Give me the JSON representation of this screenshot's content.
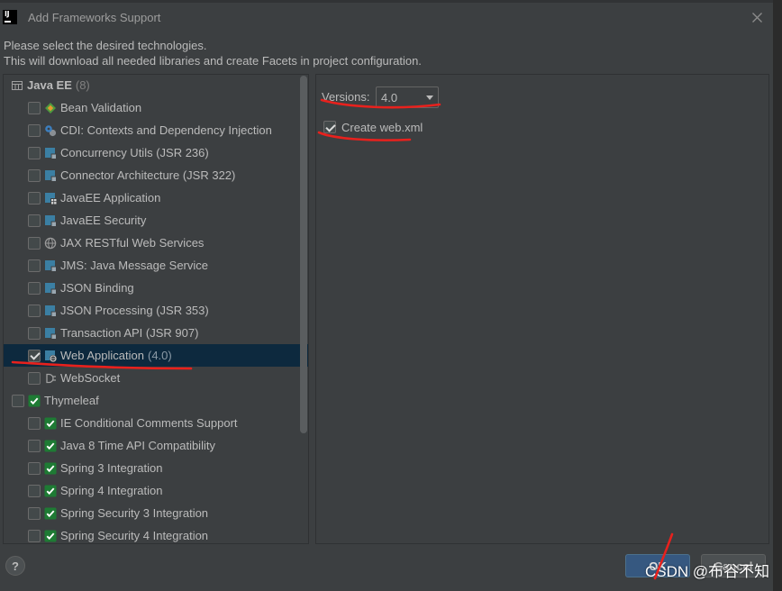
{
  "window": {
    "logo_text": "IJ",
    "title": "Add Frameworks Support",
    "logo_icon": "intellij-logo-icon",
    "close_icon": "close-icon"
  },
  "description": {
    "line1": "Please select the desired technologies.",
    "line2": "This will download all needed libraries and create Facets in project configuration."
  },
  "tree": {
    "groups": [
      {
        "label": "Java EE",
        "count": "(8)",
        "icon": "library-icon",
        "has_checkbox": false,
        "checked": false,
        "items": [
          {
            "label": "Bean Validation",
            "icon": "bean-validation-icon",
            "checked": false
          },
          {
            "label": "CDI: Contexts and Dependency Injection",
            "icon": "cdi-icon",
            "checked": false
          },
          {
            "label": "Concurrency Utils (JSR 236)",
            "icon": "javaee-icon",
            "checked": false
          },
          {
            "label": "Connector Architecture (JSR 322)",
            "icon": "javaee-icon",
            "checked": false
          },
          {
            "label": "JavaEE Application",
            "icon": "javaee-application-icon",
            "checked": false
          },
          {
            "label": "JavaEE Security",
            "icon": "javaee-icon",
            "checked": false
          },
          {
            "label": "JAX RESTful Web Services",
            "icon": "globe-icon",
            "checked": false
          },
          {
            "label": "JMS: Java Message Service",
            "icon": "javaee-icon",
            "checked": false
          },
          {
            "label": "JSON Binding",
            "icon": "javaee-icon",
            "checked": false
          },
          {
            "label": "JSON Processing (JSR 353)",
            "icon": "javaee-icon",
            "checked": false
          },
          {
            "label": "Transaction API (JSR 907)",
            "icon": "javaee-icon",
            "checked": false
          },
          {
            "label": "Web Application",
            "suffix": "(4.0)",
            "icon": "web-application-icon",
            "checked": true,
            "selected": true
          },
          {
            "label": "WebSocket",
            "icon": "websocket-icon",
            "checked": false
          }
        ]
      },
      {
        "label": "Thymeleaf",
        "icon": "thymeleaf-check-icon",
        "has_checkbox": true,
        "checked": false,
        "items": [
          {
            "label": "IE Conditional Comments Support",
            "icon": "thymeleaf-check-icon",
            "checked": false
          },
          {
            "label": "Java 8 Time API Compatibility",
            "icon": "thymeleaf-check-icon",
            "checked": false
          },
          {
            "label": "Spring 3 Integration",
            "icon": "thymeleaf-check-icon",
            "checked": false
          },
          {
            "label": "Spring 4 Integration",
            "icon": "thymeleaf-check-icon",
            "checked": false
          },
          {
            "label": "Spring Security 3 Integration",
            "icon": "thymeleaf-check-icon",
            "checked": false
          },
          {
            "label": "Spring Security 4 Integration",
            "icon": "thymeleaf-check-icon",
            "checked": false
          }
        ]
      }
    ]
  },
  "settings": {
    "versions_label": "Versions:",
    "version_value": "4.0",
    "dropdown_icon": "chevron-down-icon",
    "create_webxml_label": "Create web.xml",
    "create_webxml_checked": true
  },
  "buttons": {
    "help": "?",
    "ok": "OK",
    "cancel": "Cancel"
  },
  "watermark": "CSDN @布谷不知",
  "colors": {
    "selection_bg": "#0d293e",
    "primary_button_bg": "#365880",
    "annotation_red": "#e8211d",
    "thymeleaf_green": "#1e7b34"
  }
}
